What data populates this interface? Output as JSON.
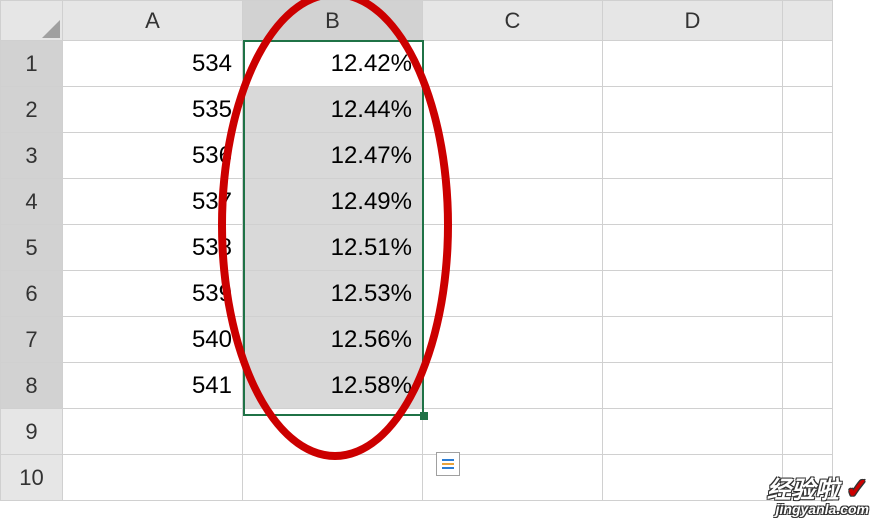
{
  "columns": [
    "A",
    "B",
    "C",
    "D",
    ""
  ],
  "rows": [
    "1",
    "2",
    "3",
    "4",
    "5",
    "6",
    "7",
    "8",
    "9",
    "10"
  ],
  "cells": {
    "A1": "534",
    "B1": "12.42%",
    "A2": "535",
    "B2": "12.44%",
    "A3": "536",
    "B3": "12.47%",
    "A4": "537",
    "B4": "12.49%",
    "A5": "538",
    "B5": "12.51%",
    "A6": "539",
    "B6": "12.53%",
    "A7": "540",
    "B7": "12.56%",
    "A8": "541",
    "B8": "12.58%"
  },
  "selection": {
    "activeCell": "B1",
    "range": "B1:B8",
    "selectedColumn": "B",
    "selectedRows": [
      1,
      2,
      3,
      4,
      5,
      6,
      7,
      8
    ]
  },
  "colors": {
    "selectionBorder": "#1f7246",
    "annotation": "#c00"
  },
  "watermark": {
    "text": "经验啦",
    "checkmark": "✓",
    "url": "jingyanla.com"
  }
}
